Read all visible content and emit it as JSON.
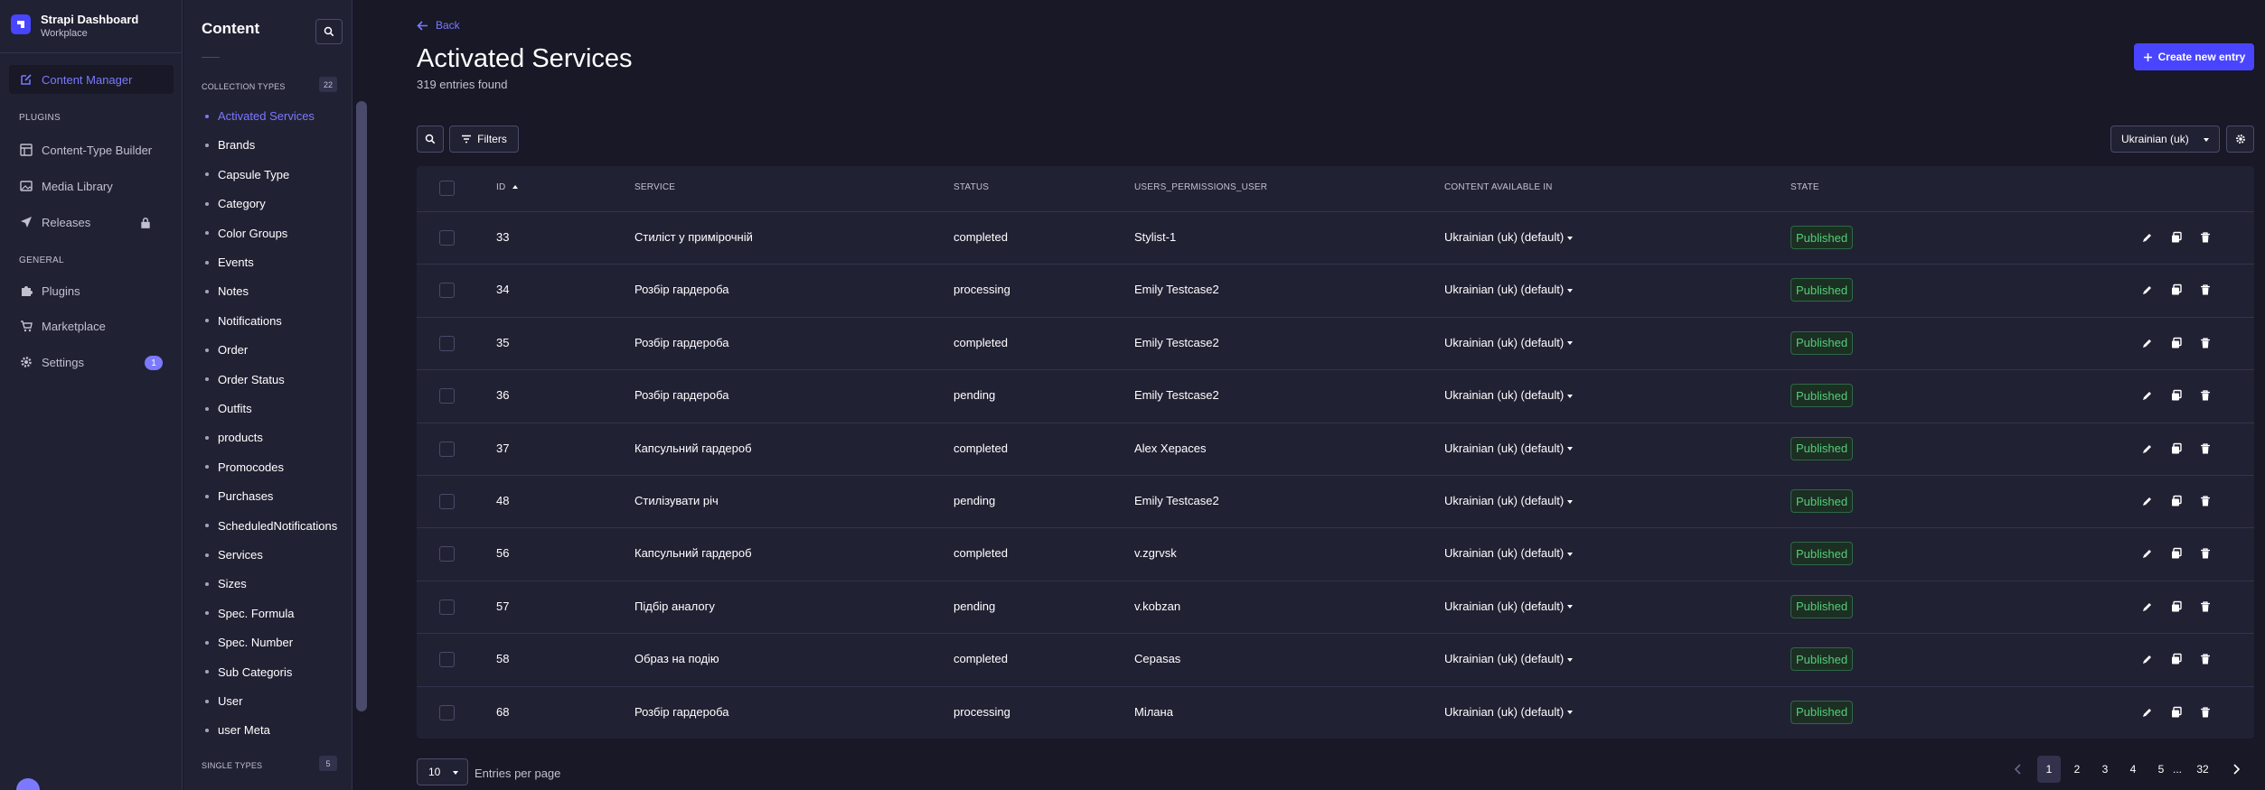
{
  "brand": {
    "title": "Strapi Dashboard",
    "subtitle": "Workplace"
  },
  "main_nav": {
    "content_manager": "Content Manager",
    "plugins_section": "PLUGINS",
    "plugins_items": [
      "Content-Type Builder",
      "Media Library",
      "Releases"
    ],
    "general_section": "GENERAL",
    "general_items": [
      "Plugins",
      "Marketplace",
      "Settings"
    ],
    "settings_badge": "1"
  },
  "sub_nav": {
    "title": "Content",
    "collection_types_label": "COLLECTION TYPES",
    "collection_types_count": "22",
    "items": [
      "Activated Services",
      "Brands",
      "Capsule Type",
      "Category",
      "Color Groups",
      "Events",
      "Notes",
      "Notifications",
      "Order",
      "Order Status",
      "Outfits",
      "products",
      "Promocodes",
      "Purchases",
      "ScheduledNotifications",
      "Services",
      "Sizes",
      "Spec. Formula",
      "Spec. Number",
      "Sub Categoris",
      "User",
      "user Meta"
    ],
    "single_types_label": "SINGLE TYPES",
    "single_types_count": "5"
  },
  "header": {
    "back": "Back",
    "title": "Activated Services",
    "subtitle": "319 entries found",
    "create_label": "Create new entry"
  },
  "toolbar": {
    "filters_label": "Filters",
    "locale": "Ukrainian (uk)"
  },
  "table": {
    "columns": [
      "ID",
      "SERVICE",
      "STATUS",
      "USERS_PERMISSIONS_USER",
      "CONTENT AVAILABLE IN",
      "STATE"
    ],
    "rows": [
      {
        "id": "33",
        "service": "Стиліст у примірочній",
        "status": "completed",
        "user": "Stylist-1",
        "locale": "Ukrainian (uk) (default)",
        "state": "Published"
      },
      {
        "id": "34",
        "service": "Розбір гардероба",
        "status": "processing",
        "user": "Emily Testcase2",
        "locale": "Ukrainian (uk) (default)",
        "state": "Published"
      },
      {
        "id": "35",
        "service": "Розбір гардероба",
        "status": "completed",
        "user": "Emily Testcase2",
        "locale": "Ukrainian (uk) (default)",
        "state": "Published"
      },
      {
        "id": "36",
        "service": "Розбір гардероба",
        "status": "pending",
        "user": "Emily Testcase2",
        "locale": "Ukrainian (uk) (default)",
        "state": "Published"
      },
      {
        "id": "37",
        "service": "Капсульний гардероб",
        "status": "completed",
        "user": "Alex Xepaces",
        "locale": "Ukrainian (uk) (default)",
        "state": "Published"
      },
      {
        "id": "48",
        "service": "Стилізувати річ",
        "status": "pending",
        "user": "Emily Testcase2",
        "locale": "Ukrainian (uk) (default)",
        "state": "Published"
      },
      {
        "id": "56",
        "service": "Капсульний гардероб",
        "status": "completed",
        "user": "v.zgrvsk",
        "locale": "Ukrainian (uk) (default)",
        "state": "Published"
      },
      {
        "id": "57",
        "service": "Підбір аналогу",
        "status": "pending",
        "user": "v.kobzan",
        "locale": "Ukrainian (uk) (default)",
        "state": "Published"
      },
      {
        "id": "58",
        "service": "Образ на подію",
        "status": "completed",
        "user": "Cepasas",
        "locale": "Ukrainian (uk) (default)",
        "state": "Published"
      },
      {
        "id": "68",
        "service": "Розбір гардероба",
        "status": "processing",
        "user": "Мілана",
        "locale": "Ukrainian (uk) (default)",
        "state": "Published"
      }
    ]
  },
  "footer": {
    "per_page": "10",
    "per_page_label": "Entries per page",
    "pages": [
      "1",
      "2",
      "3",
      "4",
      "5",
      "...",
      "32"
    ],
    "current_page": "1"
  },
  "colors": {
    "accent": "#4945ff",
    "accent_light": "#7b79ff",
    "bg": "#181826",
    "panel": "#212134",
    "success": "#55cb79"
  }
}
